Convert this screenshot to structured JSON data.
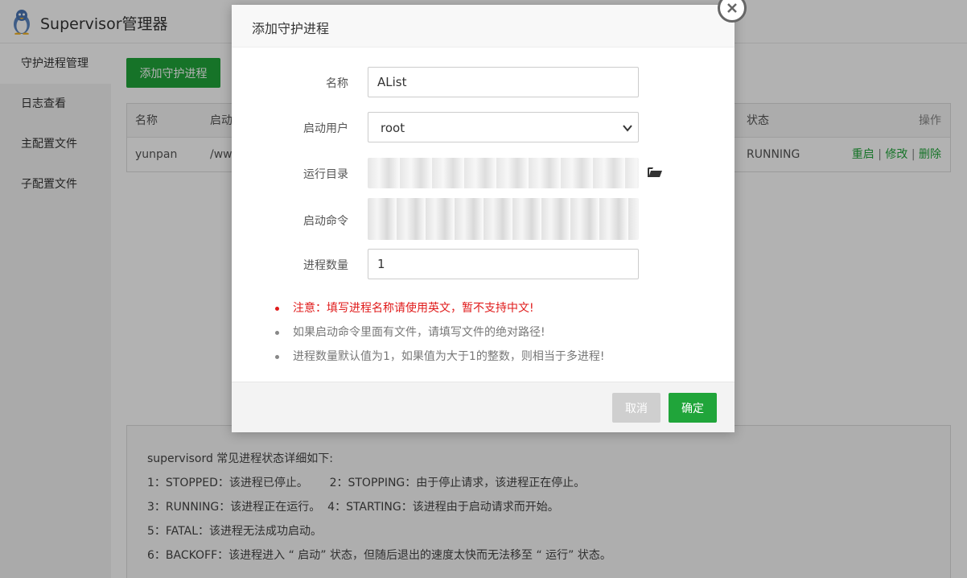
{
  "app": {
    "title": "Supervisor管理器",
    "logo_icon": "penguin-icon"
  },
  "sidebar": {
    "items": [
      {
        "label": "守护进程管理",
        "active": true
      },
      {
        "label": "日志查看",
        "active": false
      },
      {
        "label": "主配置文件",
        "active": false
      },
      {
        "label": "子配置文件",
        "active": false
      }
    ]
  },
  "main": {
    "add_button": "添加守护进程",
    "table": {
      "headers": {
        "name": "名称",
        "start": "启动",
        "status": "状态",
        "ops": "操作"
      },
      "rows": [
        {
          "name": "yunpan",
          "path": "/ww",
          "status": "RUNNING",
          "restart": "重启",
          "edit": "修改",
          "delete": "删除"
        }
      ]
    },
    "notes": {
      "title": "supervisord 常见进程状态详细如下:",
      "line1": "1：STOPPED：该进程已停止。      2：STOPPING：由于停止请求，该进程正在停止。",
      "line2": "3：RUNNING：该进程正在运行。  4：STARTING：该进程由于启动请求而开始。",
      "line3": "5：FATAL：该进程无法成功启动。",
      "line4": "6：BACKOFF：该进程进入 “ 启动” 状态，但随后退出的速度太快而无法移至 “ 运行” 状态。"
    }
  },
  "dialog": {
    "title": "添加守护进程",
    "fields": {
      "name_label": "名称",
      "name_value": "AList",
      "user_label": "启动用户",
      "user_value": "root",
      "dir_label": "运行目录",
      "cmd_label": "启动命令",
      "count_label": "进程数量",
      "count_value": "1"
    },
    "tips": [
      "注意：填写进程名称请使用英文，暂不支持中文!",
      "如果启动命令里面有文件，请填写文件的绝对路径!",
      "进程数量默认值为1，如果值为大于1的整数，则相当于多进程!"
    ],
    "cancel_label": "取消",
    "ok_label": "确定"
  },
  "colors": {
    "accent": "#20a53a",
    "warning": "#e01b1b"
  }
}
